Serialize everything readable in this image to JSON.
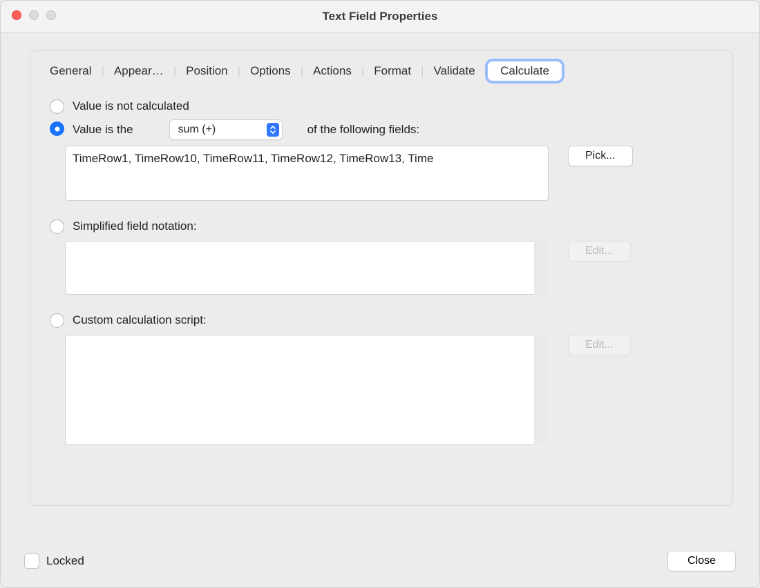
{
  "window": {
    "title": "Text Field Properties"
  },
  "tabs": {
    "general": "General",
    "appearance": "Appear…",
    "position": "Position",
    "options": "Options",
    "actions": "Actions",
    "format": "Format",
    "validate": "Validate",
    "calculate": "Calculate"
  },
  "calc": {
    "optNotCalc": "Value is not calculated",
    "optValueIs": "Value is the",
    "operation": "sum (+)",
    "suffix": "of the following fields:",
    "fieldsList": "TimeRow1, TimeRow10, TimeRow11, TimeRow12, TimeRow13, Time",
    "pick": "Pick...",
    "optSimplified": "Simplified field notation:",
    "editSimplified": "Edit...",
    "optCustom": "Custom calculation script:",
    "editCustom": "Edit..."
  },
  "footer": {
    "locked": "Locked",
    "close": "Close"
  }
}
